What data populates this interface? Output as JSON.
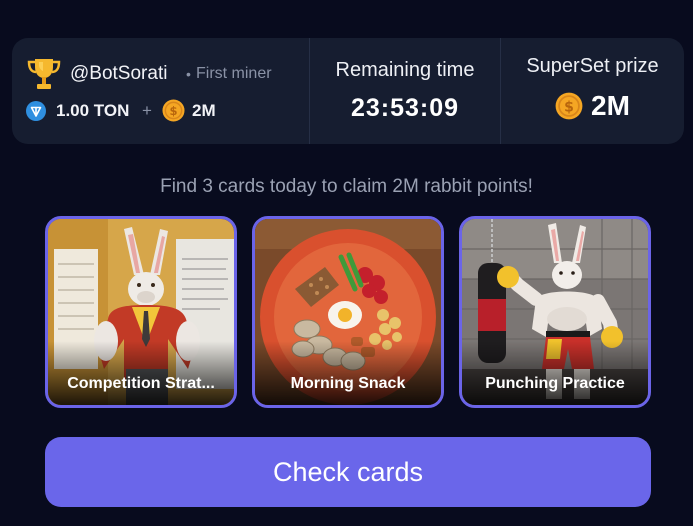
{
  "miner": {
    "handle": "@BotSorati",
    "separator": "•",
    "status": "First miner",
    "ton_amount": "1.00 TON",
    "plus": "+",
    "coin_amount": "2M",
    "icons": [
      "trophy-icon",
      "ton-icon",
      "coin-icon"
    ]
  },
  "timer": {
    "label": "Remaining time",
    "value": "23:53:09"
  },
  "prize": {
    "label": "SuperSet prize",
    "value": "2M"
  },
  "instruction": "Find 3 cards today to claim 2M rabbit points!",
  "cards": [
    {
      "title": "Competition Strat..."
    },
    {
      "title": "Morning Snack"
    },
    {
      "title": "Punching Practice"
    }
  ],
  "actions": {
    "check_label": "Check cards"
  },
  "colors": {
    "background": "#080b1e",
    "panel": "#161d30",
    "accent": "#6a66ea",
    "card_border": "#6b64e8",
    "coin": "#f5a623",
    "ton": "#2f8fe0"
  }
}
